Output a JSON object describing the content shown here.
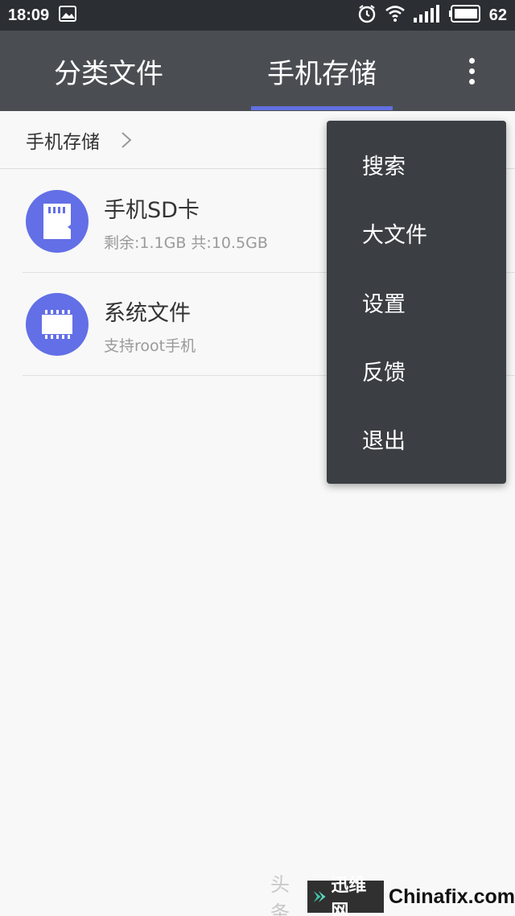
{
  "status_bar": {
    "time": "18:09",
    "battery": "62",
    "icons": [
      "image-icon",
      "alarm-icon",
      "wifi-icon",
      "signal-icon",
      "battery-icon"
    ]
  },
  "tabs": [
    {
      "label": "分类文件",
      "active": false
    },
    {
      "label": "手机存储",
      "active": true
    }
  ],
  "breadcrumb": {
    "label": "手机存储"
  },
  "files": [
    {
      "title": "手机SD卡",
      "subtitle": "剩余:1.1GB  共:10.5GB",
      "icon": "sd-card-icon"
    },
    {
      "title": "系统文件",
      "subtitle": "支持root手机",
      "icon": "chip-icon"
    }
  ],
  "menu": {
    "items": [
      "搜索",
      "大文件",
      "设置",
      "反馈",
      "退出"
    ]
  },
  "watermark": {
    "text": "头条",
    "brand": "迅维网",
    "site": "Chinafix.com"
  },
  "colors": {
    "accent": "#636fe6",
    "header": "#4a4e52",
    "status_bar": "#2b2f33",
    "menu_bg": "#3b3f43"
  }
}
